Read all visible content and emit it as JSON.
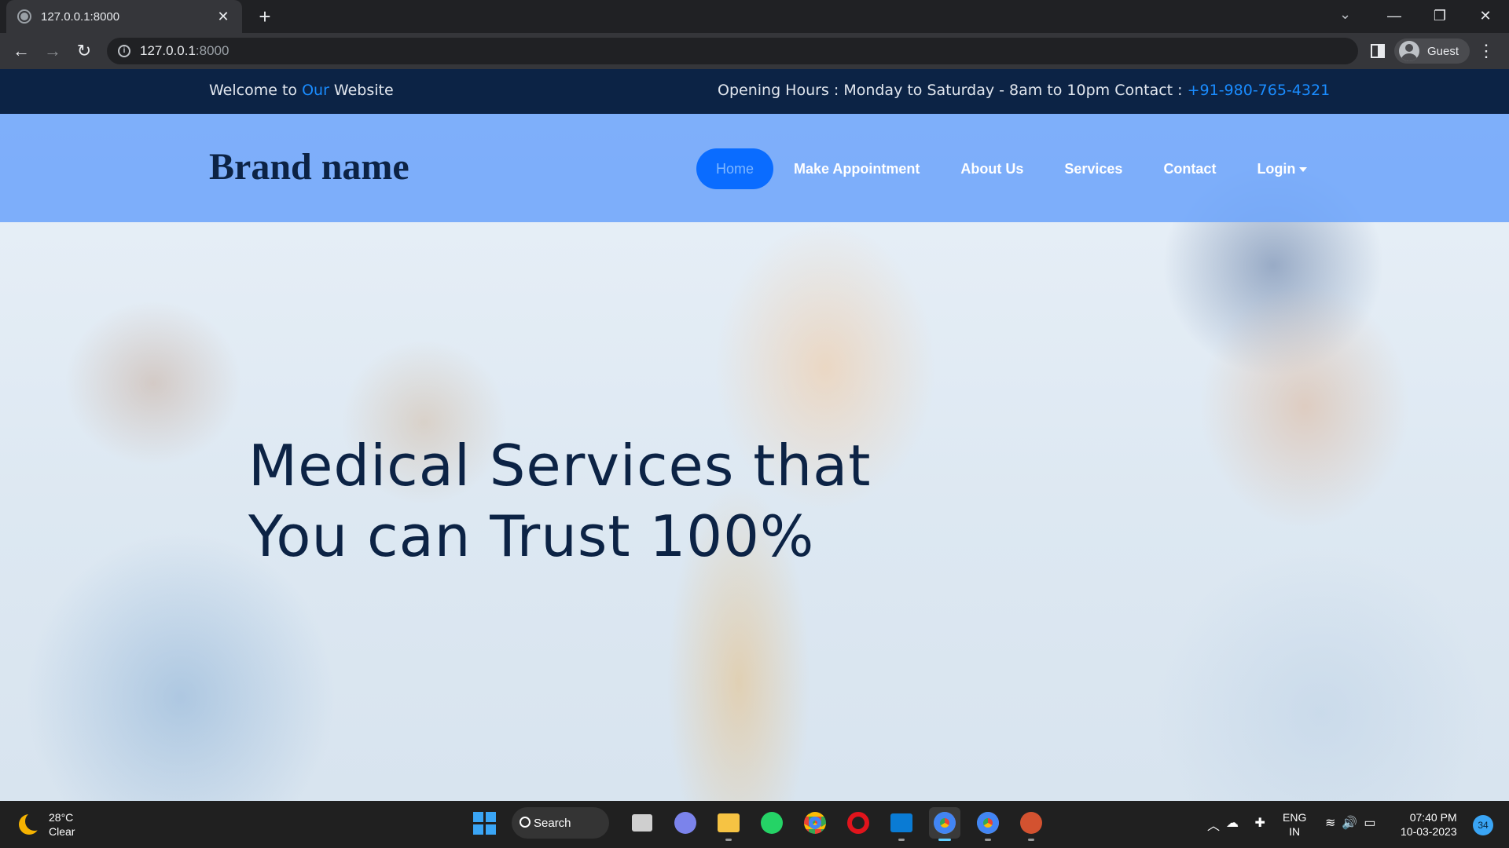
{
  "browser": {
    "tab_title": "127.0.0.1:8000",
    "url_host": "127.0.0.1",
    "url_port": ":8000",
    "profile_label": "Guest"
  },
  "site": {
    "topbar": {
      "welcome_pre": "Welcome to ",
      "welcome_accent": "Our",
      "welcome_post": " Website",
      "hours_text": "Opening Hours : Monday to Saturday - 8am to 10pm Contact : ",
      "phone": "+91-980-765-4321"
    },
    "brand": "Brand name",
    "nav": [
      {
        "label": "Home",
        "active": true
      },
      {
        "label": "Make Appointment"
      },
      {
        "label": "About Us"
      },
      {
        "label": "Services"
      },
      {
        "label": "Contact"
      },
      {
        "label": "Login"
      }
    ],
    "hero_line1": "Medical Services that",
    "hero_line2": "You can Trust 100%"
  },
  "taskbar": {
    "temperature": "28°C",
    "condition": "Clear",
    "search_label": "Search",
    "lang_line1": "ENG",
    "lang_line2": "IN",
    "time": "07:40 PM",
    "date": "10-03-2023",
    "notification_count": "34"
  }
}
